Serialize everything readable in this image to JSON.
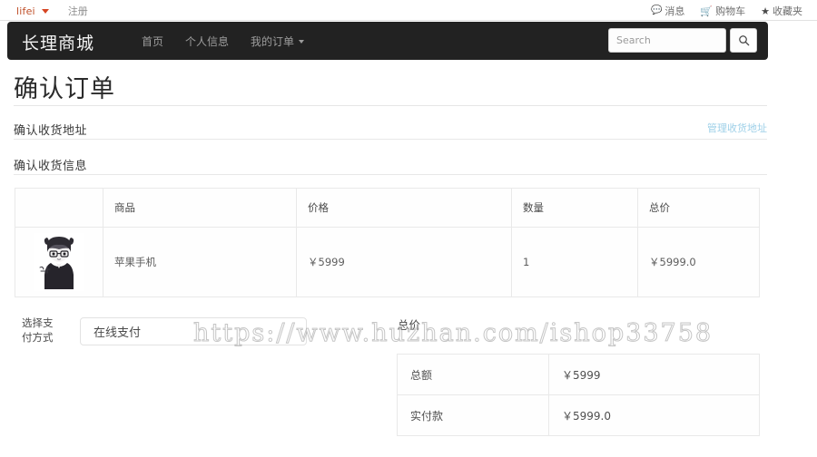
{
  "topbar": {
    "user": "lifei",
    "register_label": "注册",
    "links": [
      {
        "label": "消息",
        "icon": "message-bubble-icon"
      },
      {
        "label": "购物车",
        "icon": "shopping-cart-icon"
      },
      {
        "label": "收藏夹",
        "icon": "star-icon"
      }
    ]
  },
  "navbar": {
    "brand": "长理商城",
    "links": [
      {
        "label": "首页",
        "caret": false
      },
      {
        "label": "个人信息",
        "caret": false
      },
      {
        "label": "我的订单",
        "caret": true
      }
    ],
    "search": {
      "value": "",
      "placeholder": "Search",
      "button_icon": "search-icon"
    }
  },
  "page": {
    "title": "确认订单",
    "section_address": "确认收货地址",
    "manage_address_link": "管理收货地址",
    "section_info": "确认收货信息"
  },
  "product_table": {
    "headers": [
      "",
      "商品",
      "价格",
      "数量",
      "总价"
    ],
    "rows": [
      {
        "thumb_alt": "product-thumbnail",
        "name": "苹果手机",
        "price": "￥5999",
        "qty": "1",
        "subtotal": "￥5999.0"
      }
    ]
  },
  "payment": {
    "label": "选择支\n付方式",
    "label_line1": "选择支",
    "label_line2": "付方式",
    "selected": "在线支付"
  },
  "summary": {
    "title": "总价",
    "rows": [
      {
        "key": "总额",
        "value": "￥5999"
      },
      {
        "key": "实付款",
        "value": "￥5999.0"
      }
    ]
  },
  "watermark": "https://www.huzhan.com/ishop33758",
  "colors": {
    "navbar_bg": "#222222",
    "accent_user": "#c0502a",
    "cart_icon": "#d6452a",
    "link_blue": "#9ed0e8"
  }
}
